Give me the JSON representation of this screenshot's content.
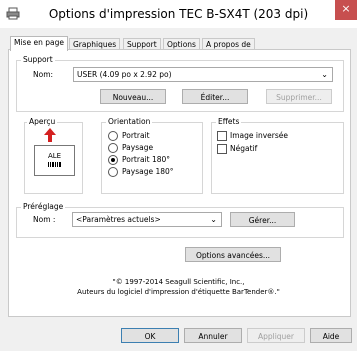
{
  "window": {
    "title": "Options d'impression TEC B-SX4T (203 dpi)",
    "close_label": "×"
  },
  "tabs": [
    {
      "label": "Mise en page"
    },
    {
      "label": "Graphiques"
    },
    {
      "label": "Support"
    },
    {
      "label": "Options"
    },
    {
      "label": "A propos de"
    }
  ],
  "support": {
    "group_label": "Support",
    "name_label": "Nom:",
    "name_value": "USER (4.09 po x 2.92 po)",
    "new_button": "Nouveau...",
    "edit_button": "Éditer...",
    "delete_button": "Supprimer..."
  },
  "apercu": {
    "group_label": "Aperçu",
    "preview_text": "ALE"
  },
  "orientation": {
    "group_label": "Orientation",
    "options": [
      {
        "label": "Portrait",
        "selected": false
      },
      {
        "label": "Paysage",
        "selected": false
      },
      {
        "label": "Portrait 180°",
        "selected": true
      },
      {
        "label": "Paysage 180°",
        "selected": false
      }
    ]
  },
  "effets": {
    "group_label": "Effets",
    "options": [
      {
        "label": "Image inversée",
        "checked": false
      },
      {
        "label": "Négatif",
        "checked": false
      }
    ]
  },
  "preset": {
    "group_label": "Préréglage",
    "name_label": "Nom :",
    "name_value": "<Paramètres actuels>",
    "manage_button": "Gérer..."
  },
  "advanced_button": "Options avancées...",
  "copyright": {
    "line1": "\"© 1997-2014 Seagull Scientific, Inc.,",
    "line2": "Auteurs du logiciel d'impression d'étiquette BarTender®.\""
  },
  "dialog_buttons": {
    "ok": "OK",
    "cancel": "Annuler",
    "apply": "Appliquer",
    "help": "Aide"
  },
  "colors": {
    "close_bg": "#c74f4f",
    "arrow": "#d42020"
  }
}
